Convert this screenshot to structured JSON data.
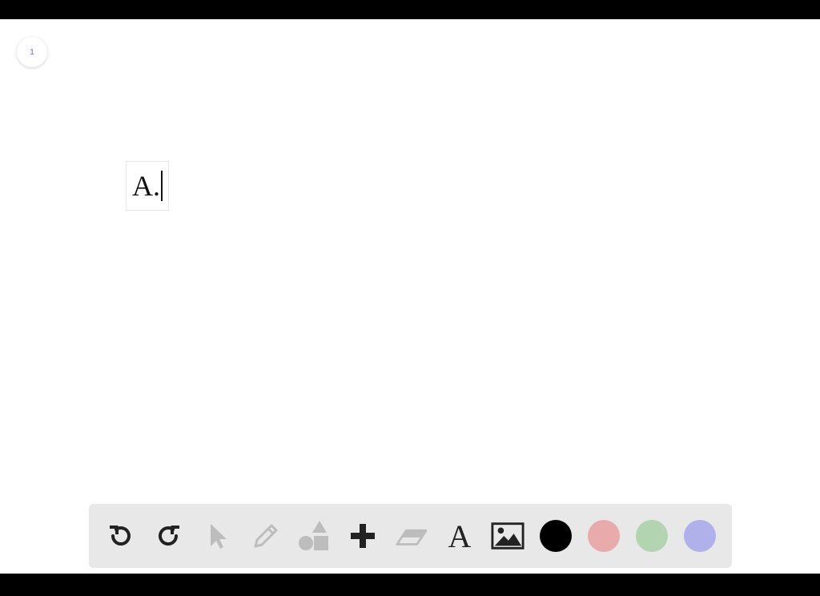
{
  "page": {
    "number": "1"
  },
  "text_box": {
    "content": "A."
  },
  "toolbar": {
    "tools": [
      {
        "name": "undo-icon",
        "enabled": true
      },
      {
        "name": "redo-icon",
        "enabled": true
      },
      {
        "name": "select-pointer-icon",
        "enabled": false
      },
      {
        "name": "pencil-icon",
        "enabled": false
      },
      {
        "name": "shapes-icon",
        "enabled": false
      },
      {
        "name": "plus-icon",
        "enabled": true
      },
      {
        "name": "eraser-icon",
        "enabled": false
      },
      {
        "name": "text-tool-icon",
        "label": "A",
        "enabled": true
      },
      {
        "name": "image-icon",
        "enabled": true
      }
    ],
    "colors": [
      {
        "name": "black",
        "hex": "#000000"
      },
      {
        "name": "pink",
        "hex": "#e8aaaa"
      },
      {
        "name": "green",
        "hex": "#b2d4b0"
      },
      {
        "name": "blue",
        "hex": "#b0b0ea"
      }
    ]
  }
}
